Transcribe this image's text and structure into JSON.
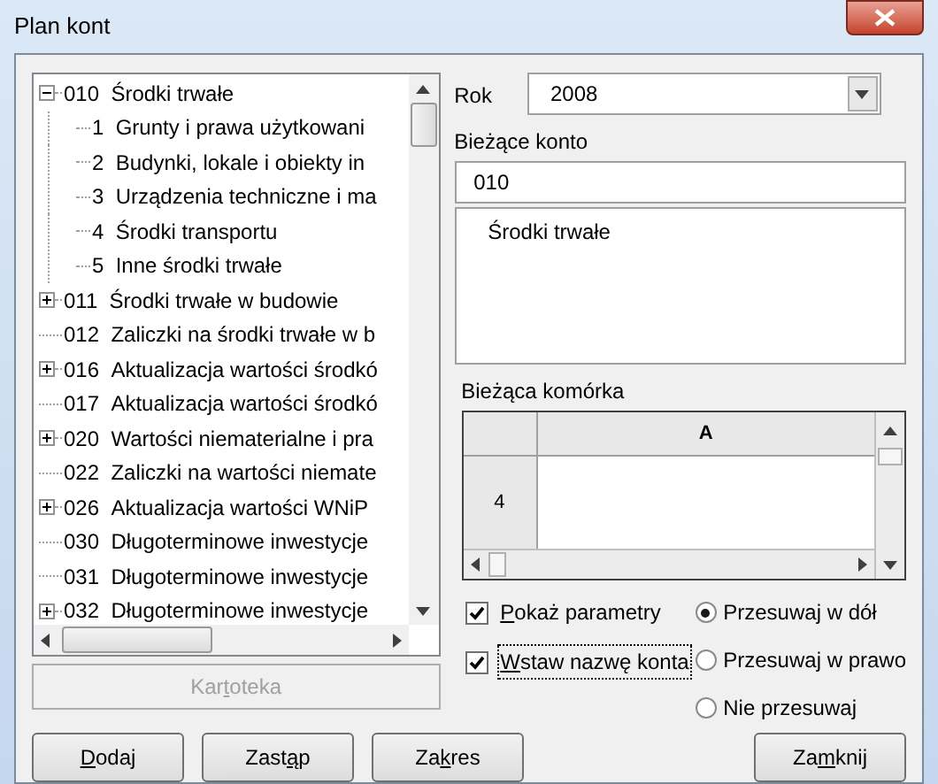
{
  "window": {
    "title": "Plan kont"
  },
  "tree": {
    "items": [
      {
        "code": "010",
        "name": "Środki trwałe",
        "expanded": true,
        "children": [
          {
            "code": "1",
            "name": "Grunty i prawa użytkowani"
          },
          {
            "code": "2",
            "name": "Budynki, lokale i obiekty in"
          },
          {
            "code": "3",
            "name": "Urządzenia techniczne i ma"
          },
          {
            "code": "4",
            "name": "Środki transportu"
          },
          {
            "code": "5",
            "name": "Inne środki trwałe"
          }
        ]
      },
      {
        "code": "011",
        "name": "Środki trwałe w budowie",
        "expanded": false
      },
      {
        "code": "012",
        "name": "Zaliczki na środki trwałe w b"
      },
      {
        "code": "016",
        "name": "Aktualizacja wartości środkó",
        "expanded": false
      },
      {
        "code": "017",
        "name": "Aktualizacja wartości środkó"
      },
      {
        "code": "020",
        "name": "Wartości niematerialne i pra",
        "expanded": false
      },
      {
        "code": "022",
        "name": "Zaliczki na wartości niemate"
      },
      {
        "code": "026",
        "name": "Aktualizacja wartości WNiP",
        "expanded": false
      },
      {
        "code": "030",
        "name": "Długoterminowe inwestycje"
      },
      {
        "code": "031",
        "name": "Długoterminowe inwestycje"
      },
      {
        "code": "032",
        "name": "Długoterminowe inwestycje",
        "expanded": false
      }
    ]
  },
  "kartoteka_button": {
    "label": {
      "before": "Kar",
      "key": "t",
      "after": "oteka"
    },
    "disabled": true
  },
  "year": {
    "label": "Rok",
    "value": "2008"
  },
  "current_account": {
    "label": "Bieżące konto",
    "code": "010",
    "name": "Środki trwałe"
  },
  "current_cell": {
    "label": "Bieżąca komórka",
    "column": "A",
    "row": "4"
  },
  "checkboxes": [
    {
      "label": {
        "key": "P",
        "after": "okaż parametry"
      },
      "checked": true,
      "focused": false
    },
    {
      "label": {
        "key": "W",
        "after": "staw nazwę konta"
      },
      "checked": true,
      "focused": true
    }
  ],
  "radios": [
    {
      "label": "Przesuwaj w dół",
      "selected": true
    },
    {
      "label": "Przesuwaj w prawo",
      "selected": false
    },
    {
      "label": "Nie przesuwaj",
      "selected": false
    }
  ],
  "buttons": [
    {
      "label": {
        "key": "D",
        "after": "odaj"
      }
    },
    {
      "label": {
        "before": "Zast",
        "key": "ą",
        "after": "p"
      }
    },
    {
      "label": {
        "before": "Za",
        "key": "k",
        "after": "res"
      }
    },
    {
      "label": {
        "before": "Za",
        "key": "m",
        "after": "knij"
      }
    }
  ]
}
